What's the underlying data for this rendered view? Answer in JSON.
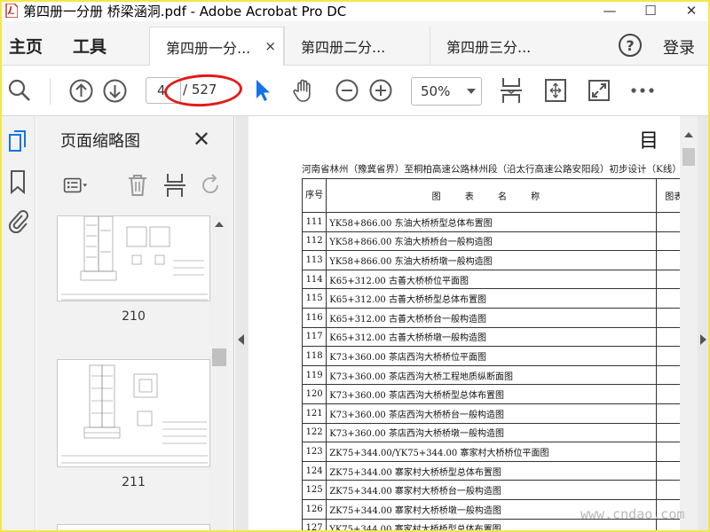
{
  "window": {
    "title": "第四册一分册  桥梁涵洞.pdf - Adobe Acrobat Pro DC",
    "minimize": "—",
    "maximize": "☐",
    "close": "✕"
  },
  "menu": {
    "home": "主页",
    "tools": "工具",
    "help": "?",
    "login": "登录"
  },
  "tabs": [
    {
      "label": "第四册一分...",
      "close": "×",
      "active": true
    },
    {
      "label": "第四册二分..."
    },
    {
      "label": "第四册三分..."
    }
  ],
  "toolbar": {
    "current_page": "4",
    "total_pages": "/ 527",
    "zoom": "50%",
    "icons": [
      "search-icon",
      "previous-page-icon",
      "next-page-icon",
      "select-cursor-icon",
      "hand-icon",
      "zoom-out-icon",
      "zoom-in-icon",
      "scroll-mode-icon",
      "fit-page-icon",
      "full-screen-icon",
      "more-icon"
    ]
  },
  "sidebar": {
    "panel_title": "页面缩略图",
    "close": "✕",
    "thumbnails": [
      {
        "label": "210"
      },
      {
        "label": "211"
      }
    ]
  },
  "document": {
    "heading": "目",
    "subtitle": "河南省林州（豫冀省界）至桐柏高速公路林州段（沿太行高速公路安阳段）初步设计（K线）",
    "columns": {
      "no": "序号",
      "name": "图 表 名 称",
      "fig": "图表"
    },
    "rows": [
      {
        "no": "111",
        "name": "YK58+866.00 东油大桥桥型总体布置图"
      },
      {
        "no": "112",
        "name": "YK58+866.00 东油大桥桥台一般构造图"
      },
      {
        "no": "113",
        "name": "YK58+866.00 东油大桥桥墩一般构造图"
      },
      {
        "no": "114",
        "name": "K65+312.00 古善大桥桥位平面图"
      },
      {
        "no": "115",
        "name": "K65+312.00 古善大桥桥型总体布置图"
      },
      {
        "no": "116",
        "name": "K65+312.00 古善大桥桥台一般构造图"
      },
      {
        "no": "117",
        "name": "K65+312.00 古善大桥桥墩一般构造图"
      },
      {
        "no": "118",
        "name": "K73+360.00 茶店西沟大桥桥位平面图"
      },
      {
        "no": "119",
        "name": "K73+360.00 茶店西沟大桥工程地质纵断面图"
      },
      {
        "no": "120",
        "name": "K73+360.00 茶店西沟大桥桥型总体布置图"
      },
      {
        "no": "121",
        "name": "K73+360.00 茶店西沟大桥桥台一般构造图"
      },
      {
        "no": "122",
        "name": "K73+360.00 茶店西沟大桥桥墩一般构造图"
      },
      {
        "no": "123",
        "name": "ZK75+344.00/YK75+344.00 寨家村大桥桥位平面图"
      },
      {
        "no": "124",
        "name": "ZK75+344.00 寨家村大桥桥型总体布置图"
      },
      {
        "no": "125",
        "name": "ZK75+344.00 寨家村大桥桥台一般构造图"
      },
      {
        "no": "126",
        "name": "ZK75+344.00 寨家村大桥桥墩一般构造图"
      },
      {
        "no": "127",
        "name": "YK75+344.00 寨家村大桥桥型总体布置图"
      }
    ]
  },
  "watermark": "www.cndao.com",
  "colors": {
    "accent_cursor": "#1473e6",
    "annotation_red": "#e21b1b",
    "frame_yellow": "#f3e74a"
  }
}
